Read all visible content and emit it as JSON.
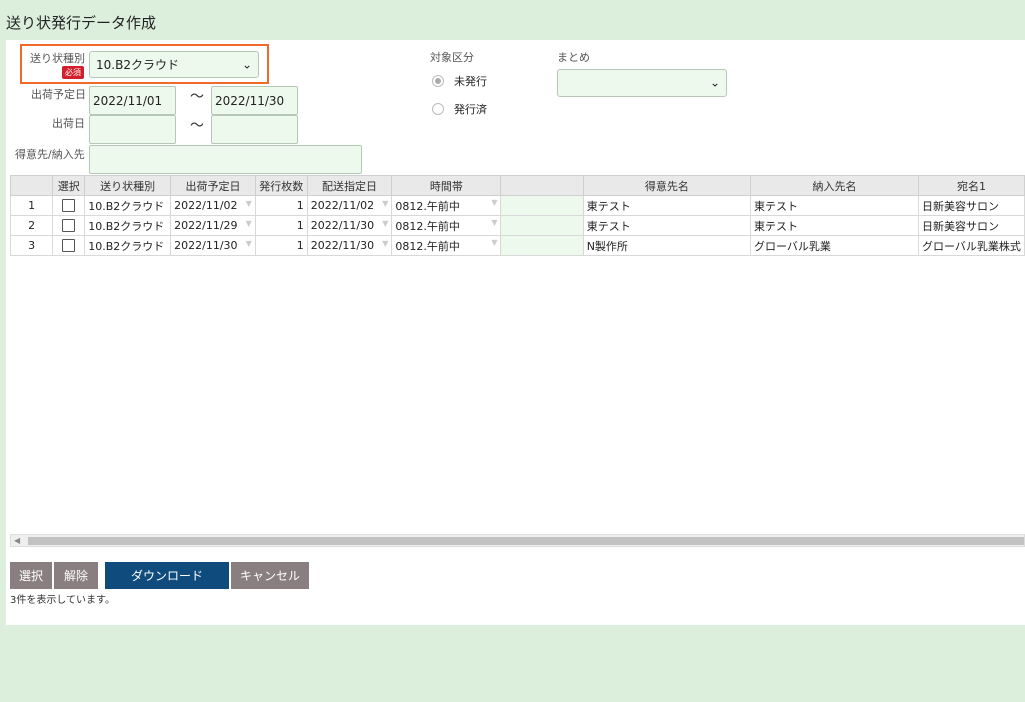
{
  "page_title": "送り状発行データ作成",
  "form": {
    "invoice_type": {
      "label": "送り状種別",
      "required_badge": "必須",
      "value": "10.B2クラウド"
    },
    "ship_date": {
      "label": "出荷予定日",
      "from": "2022/11/01",
      "tilde": "〜",
      "to": "2022/11/30"
    },
    "shipped_date": {
      "label": "出荷日",
      "from": "",
      "tilde": "〜",
      "to": ""
    },
    "customer": {
      "label": "得意先/納入先",
      "value": ""
    },
    "target": {
      "label": "対象区分",
      "options": [
        {
          "label": "未発行",
          "checked": true
        },
        {
          "label": "発行済",
          "checked": false
        }
      ]
    },
    "summary": {
      "label": "まとめ",
      "value": ""
    }
  },
  "table": {
    "headers": [
      "",
      "選択",
      "送り状種別",
      "出荷予定日",
      "発行枚数",
      "配送指定日",
      "時間帯",
      "",
      "得意先名",
      "納入先名",
      "宛名1"
    ],
    "rows": [
      {
        "no": "1",
        "type": "10.B2クラウド",
        "ship_date": "2022/11/02",
        "count": "1",
        "delivery_date": "2022/11/02",
        "time": "0812.午前中",
        "blank": "",
        "customer": "東テスト",
        "dest": "東テスト",
        "addressee": "日新美容サロン"
      },
      {
        "no": "2",
        "type": "10.B2クラウド",
        "ship_date": "2022/11/29",
        "count": "1",
        "delivery_date": "2022/11/30",
        "time": "0812.午前中",
        "blank": "",
        "customer": "東テスト",
        "dest": "東テスト",
        "addressee": "日新美容サロン"
      },
      {
        "no": "3",
        "type": "10.B2クラウド",
        "ship_date": "2022/11/30",
        "count": "1",
        "delivery_date": "2022/11/30",
        "time": "0812.午前中",
        "blank": "",
        "customer": "N製作所",
        "dest": "グローバル乳業",
        "addressee": "グローバル乳業株式"
      }
    ]
  },
  "buttons": {
    "select": "選択",
    "clear": "解除",
    "download": "ダウンロード",
    "cancel": "キャンセル"
  },
  "status_text": "3件を表示しています。"
}
